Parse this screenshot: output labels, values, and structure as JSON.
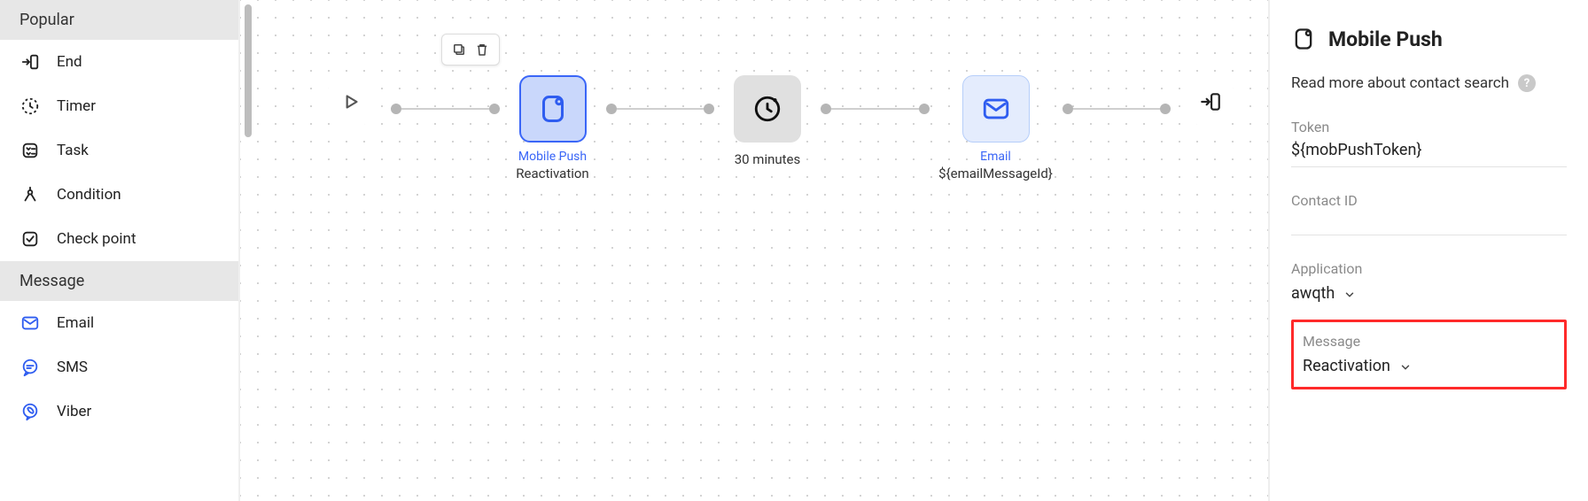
{
  "sidebar": {
    "sections": [
      {
        "header": "Popular",
        "items": [
          {
            "id": "end",
            "label": "End"
          },
          {
            "id": "timer",
            "label": "Timer"
          },
          {
            "id": "task",
            "label": "Task"
          },
          {
            "id": "condition",
            "label": "Condition"
          },
          {
            "id": "checkpoint",
            "label": "Check point"
          }
        ]
      },
      {
        "header": "Message",
        "items": [
          {
            "id": "email",
            "label": "Email"
          },
          {
            "id": "sms",
            "label": "SMS"
          },
          {
            "id": "viber",
            "label": "Viber"
          }
        ]
      }
    ]
  },
  "canvas": {
    "nodes": {
      "start": {
        "type": "play"
      },
      "push": {
        "type": "mobile-push",
        "top_label": "Mobile Push",
        "bot_label": "Reactivation"
      },
      "timer": {
        "type": "timer",
        "bot_label": "30 minutes"
      },
      "email": {
        "type": "email",
        "top_label": "Email",
        "bot_label": "${emailMessageId}"
      },
      "end": {
        "type": "end"
      }
    }
  },
  "panel": {
    "title": "Mobile Push",
    "read_more": "Read more about contact search",
    "fields": {
      "token": {
        "label": "Token",
        "value": "${mobPushToken}"
      },
      "contact_id": {
        "label": "Contact ID",
        "value": ""
      },
      "application": {
        "label": "Application",
        "value": "awqth"
      },
      "message": {
        "label": "Message",
        "value": "Reactivation"
      }
    }
  }
}
